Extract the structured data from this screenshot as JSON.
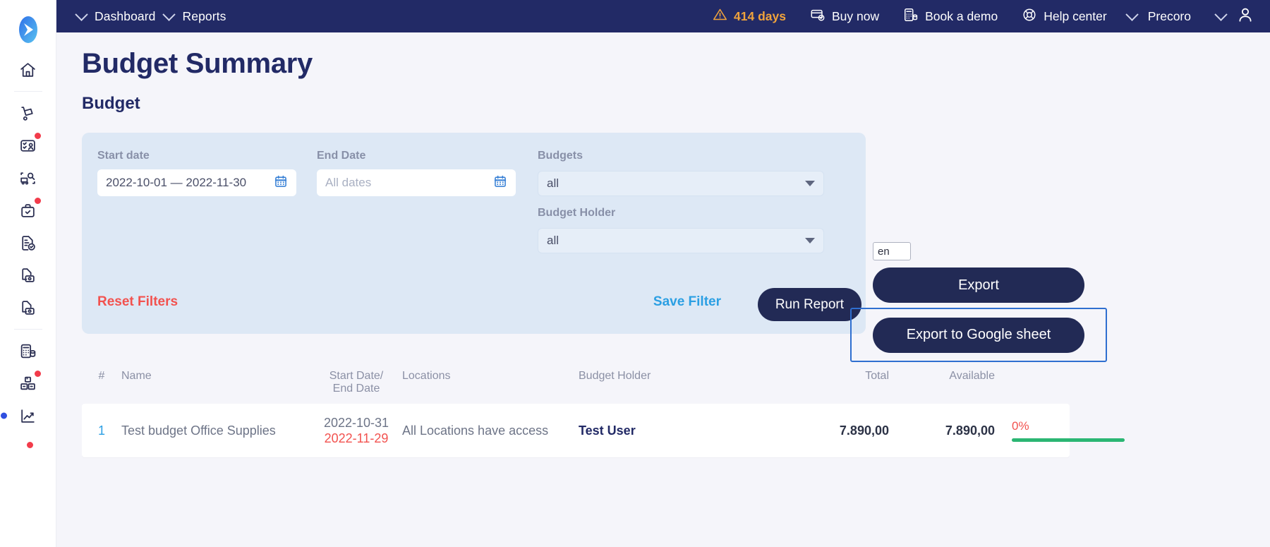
{
  "topbar": {
    "breadcrumb": [
      {
        "label": "Dashboard",
        "icon": "chevron-down-icon"
      },
      {
        "label": "Reports",
        "icon": "chevron-down-icon"
      }
    ],
    "trial": {
      "label": "414 days",
      "icon": "warning-triangle-icon",
      "color": "#f0a33c"
    },
    "buy_now": {
      "label": "Buy now",
      "icon": "credit-card-icon"
    },
    "book_demo": {
      "label": "Book a demo",
      "icon": "calculator-icon"
    },
    "help_center": {
      "label": "Help center",
      "icon": "lifebuoy-icon"
    },
    "account": {
      "label": "Precoro",
      "icon": "chevron-down-icon"
    },
    "user": {
      "icon": "user-avatar-icon",
      "caret": "chevron-down-icon"
    },
    "bg_color": "#222a66"
  },
  "sidebar": {
    "logo": "precoro-logo-icon",
    "items": [
      {
        "name": "home",
        "icon": "house-icon",
        "badge": false
      },
      {
        "name": "purchase-requisitions",
        "icon": "hand-truck-icon",
        "badge": false
      },
      {
        "name": "requests",
        "icon": "id-card-check-icon",
        "badge": true
      },
      {
        "name": "rfq",
        "icon": "truck-search-icon",
        "badge": false
      },
      {
        "name": "orders",
        "icon": "briefcase-check-icon",
        "badge": true
      },
      {
        "name": "receipts",
        "icon": "document-check-icon",
        "badge": false
      },
      {
        "name": "invoices",
        "icon": "document-money-icon",
        "badge": false
      },
      {
        "name": "expenses",
        "icon": "document-money-icon",
        "badge": false
      },
      {
        "name": "budgets",
        "icon": "calculator-coins-icon",
        "badge": false
      },
      {
        "name": "warehouse",
        "icon": "boxes-icon",
        "badge": true
      },
      {
        "name": "reports",
        "icon": "line-chart-up-icon",
        "badge": false,
        "active": true
      }
    ]
  },
  "page": {
    "title": "Budget Summary",
    "section": "Budget"
  },
  "filters": {
    "start_date": {
      "label": "Start date",
      "value": "2022-10-01 — 2022-11-30",
      "icon": "calendar-icon"
    },
    "end_date": {
      "label": "End Date",
      "value": "",
      "placeholder": "All dates",
      "icon": "calendar-icon"
    },
    "budgets": {
      "label": "Budgets",
      "value": "all",
      "icon": "caret-down-icon"
    },
    "budget_holder": {
      "label": "Budget Holder",
      "value": "all",
      "icon": "caret-down-icon"
    },
    "reset": "Reset Filters",
    "save": "Save Filter",
    "run": "Run Report",
    "panel_color": "#dde8f5",
    "reset_color": "#f2524f",
    "save_color": "#2b9fe3",
    "run_color": "#222a55"
  },
  "export": {
    "lang_value": "en",
    "export_label": "Export",
    "gsheet_label": "Export to Google sheet",
    "highlight_color": "#2f6fd0",
    "button_color": "#222a55"
  },
  "table": {
    "columns": [
      "#",
      "Name",
      "Start Date/\nEnd Date",
      "Locations",
      "Budget Holder",
      "Total",
      "Available",
      ""
    ],
    "columns_flat": {
      "num": "#",
      "name": "Name",
      "dates_line1": "Start Date/",
      "dates_line2": "End Date",
      "locations": "Locations",
      "holder": "Budget Holder",
      "total": "Total",
      "available": "Available"
    },
    "rows": [
      {
        "num": "1",
        "name": "Test budget Office Supplies",
        "start_date": "2022-10-31",
        "end_date": "2022-11-29",
        "locations": "All Locations have access",
        "holder": "Test User",
        "total": "7.890,00",
        "available": "7.890,00",
        "percent_label": "0%",
        "percent_value": 0,
        "bar_color": "#2bb673",
        "percent_color": "#f2524f"
      }
    ]
  }
}
